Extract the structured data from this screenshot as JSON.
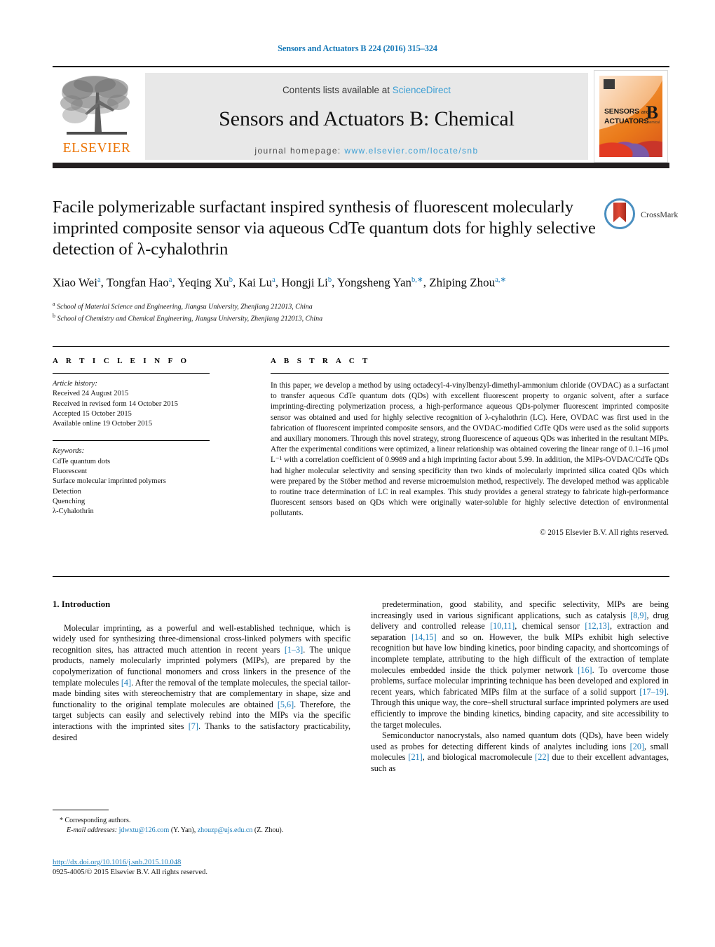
{
  "running_head": "Sensors and Actuators B 224 (2016) 315–324",
  "masthead": {
    "contents_prefix": "Contents lists available at ",
    "sciencedirect": "ScienceDirect",
    "journal_title": "Sensors and Actuators B: Chemical",
    "homepage_label": "journal homepage: ",
    "homepage_url": "www.elsevier.com/locate/snb",
    "publisher_logo_text": "ELSEVIER",
    "cover": {
      "line1": "SENSORS",
      "and": "and",
      "line2": "ACTUATORS",
      "volume_letter": "B",
      "volume_sub": "Chemical"
    }
  },
  "crossmark": {
    "label": "CrossMark"
  },
  "title": "Facile polymerizable surfactant inspired synthesis of fluorescent molecularly imprinted composite sensor via aqueous CdTe quantum dots for highly selective detection of λ-cyhalothrin",
  "authors_html": "Xiao Wei<sup>a</sup>, Tongfan Hao<sup>a</sup>, Yeqing Xu<sup>b</sup>, Kai Lu<sup>a</sup>, Hongji Li<sup>b</sup>, Yongsheng Yan<sup>b,∗</sup>, Zhiping Zhou<sup>a,∗</sup>",
  "affiliations": [
    {
      "marker": "a",
      "text": "School of Material Science and Engineering, Jiangsu University, Zhenjiang 212013, China"
    },
    {
      "marker": "b",
      "text": "School of Chemistry and Chemical Engineering, Jiangsu University, Zhenjiang 212013, China"
    }
  ],
  "article_info": {
    "heading": "A R T I C L E    I N F O",
    "history_label": "Article history:",
    "history": [
      "Received 24 August 2015",
      "Received in revised form 14 October 2015",
      "Accepted 15 October 2015",
      "Available online 19 October 2015"
    ],
    "keywords_label": "Keywords:",
    "keywords": [
      "CdTe quantum dots",
      "Fluorescent",
      "Surface molecular imprinted polymers",
      "Detection",
      "Quenching",
      "λ-Cyhalothrin"
    ]
  },
  "abstract": {
    "heading": "A B S T R A C T",
    "text": "In this paper, we develop a method by using octadecyl-4-vinylbenzyl-dimethyl-ammonium chloride (OVDAC) as a surfactant to transfer aqueous CdTe quantum dots (QDs) with excellent fluorescent property to organic solvent, after a surface imprinting-directing polymerization process, a high-performance aqueous QDs-polymer fluorescent imprinted composite sensor was obtained and used for highly selective recognition of λ-cyhalothrin (LC). Here, OVDAC was first used in the fabrication of fluorescent imprinted composite sensors, and the OVDAC-modified CdTe QDs were used as the solid supports and auxiliary monomers. Through this novel strategy, strong fluorescence of aqueous QDs was inherited in the resultant MIPs. After the experimental conditions were optimized, a linear relationship was obtained covering the linear range of 0.1–16 μmol L⁻¹ with a correlation coefficient of 0.9989 and a high imprinting factor about 5.99. In addition, the MIPs-OVDAC/CdTe QDs had higher molecular selectivity and sensing specificity than two kinds of molecularly imprinted silica coated QDs which were prepared by the Stöber method and reverse microemulsion method, respectively. The developed method was applicable to routine trace determination of LC in real examples. This study provides a general strategy to fabricate high-performance fluorescent sensors based on QDs which were originally water-soluble for highly selective detection of environmental pollutants.",
    "copyright": "© 2015 Elsevier B.V. All rights reserved."
  },
  "body": {
    "section_heading": "1.  Introduction",
    "left_paragraph_html": "Molecular imprinting, as a powerful and well-established technique, which is widely used for synthesizing three-dimensional cross-linked polymers with specific recognition sites, has attracted much attention in recent years <span class=\"ref\">[1–3]</span>. The unique products, namely molecularly imprinted polymers (MIPs), are prepared by the copolymerization of functional monomers and cross linkers in the presence of the template molecules <span class=\"ref\">[4]</span>. After the removal of the template molecules, the special tailor-made binding sites with stereochemistry that are complementary in shape, size and functionality to the original template molecules are obtained <span class=\"ref\">[5,6]</span>. Therefore, the target subjects can easily and selectively rebind into the MIPs via the specific interactions with the imprinted sites <span class=\"ref\">[7]</span>. Thanks to the satisfactory practicability, desired",
    "right_paragraph1_html": "predetermination, good stability, and specific selectivity, MIPs are being increasingly used in various significant applications, such as catalysis <span class=\"ref\">[8,9]</span>, drug delivery and controlled release <span class=\"ref\">[10,11]</span>, chemical sensor <span class=\"ref\">[12,13]</span>, extraction and separation <span class=\"ref\">[14,15]</span> and so on. However, the bulk MIPs exhibit high selective recognition but have low binding kinetics, poor binding capacity, and shortcomings of incomplete template, attributing to the high difficult of the extraction of template molecules embedded inside the thick polymer network <span class=\"ref\">[16]</span>. To overcome those problems, surface molecular imprinting technique has been developed and explored in recent years, which fabricated MIPs film at the surface of a solid support <span class=\"ref\">[17–19]</span>. Through this unique way, the core–shell structural surface imprinted polymers are used efficiently to improve the binding kinetics, binding capacity, and site accessibility to the target molecules.",
    "right_paragraph2_html": "Semiconductor nanocrystals, also named quantum dots (QDs), have been widely used as probes for detecting different kinds of analytes including ions <span class=\"ref\">[20]</span>, small molecules <span class=\"ref\">[21]</span>, and biological macromolecule <span class=\"ref\">[22]</span> due to their excellent advantages, such as"
  },
  "footnote": {
    "corresponding": "*  Corresponding authors.",
    "email_label": "E-mail addresses:",
    "email1": "jdwxtu@126.com",
    "email1_owner": "(Y. Yan),",
    "email2": "zhouzp@ujs.edu.cn",
    "email2_owner": "(Z. Zhou)."
  },
  "doi": {
    "url": "http://dx.doi.org/10.1016/j.snb.2015.10.048",
    "issn_line": "0925-4005/© 2015 Elsevier B.V. All rights reserved."
  },
  "colors": {
    "link_blue": "#1a7bb9",
    "sciencedirect_blue": "#3d9fd4",
    "elsevier_orange": "#ec7404"
  }
}
